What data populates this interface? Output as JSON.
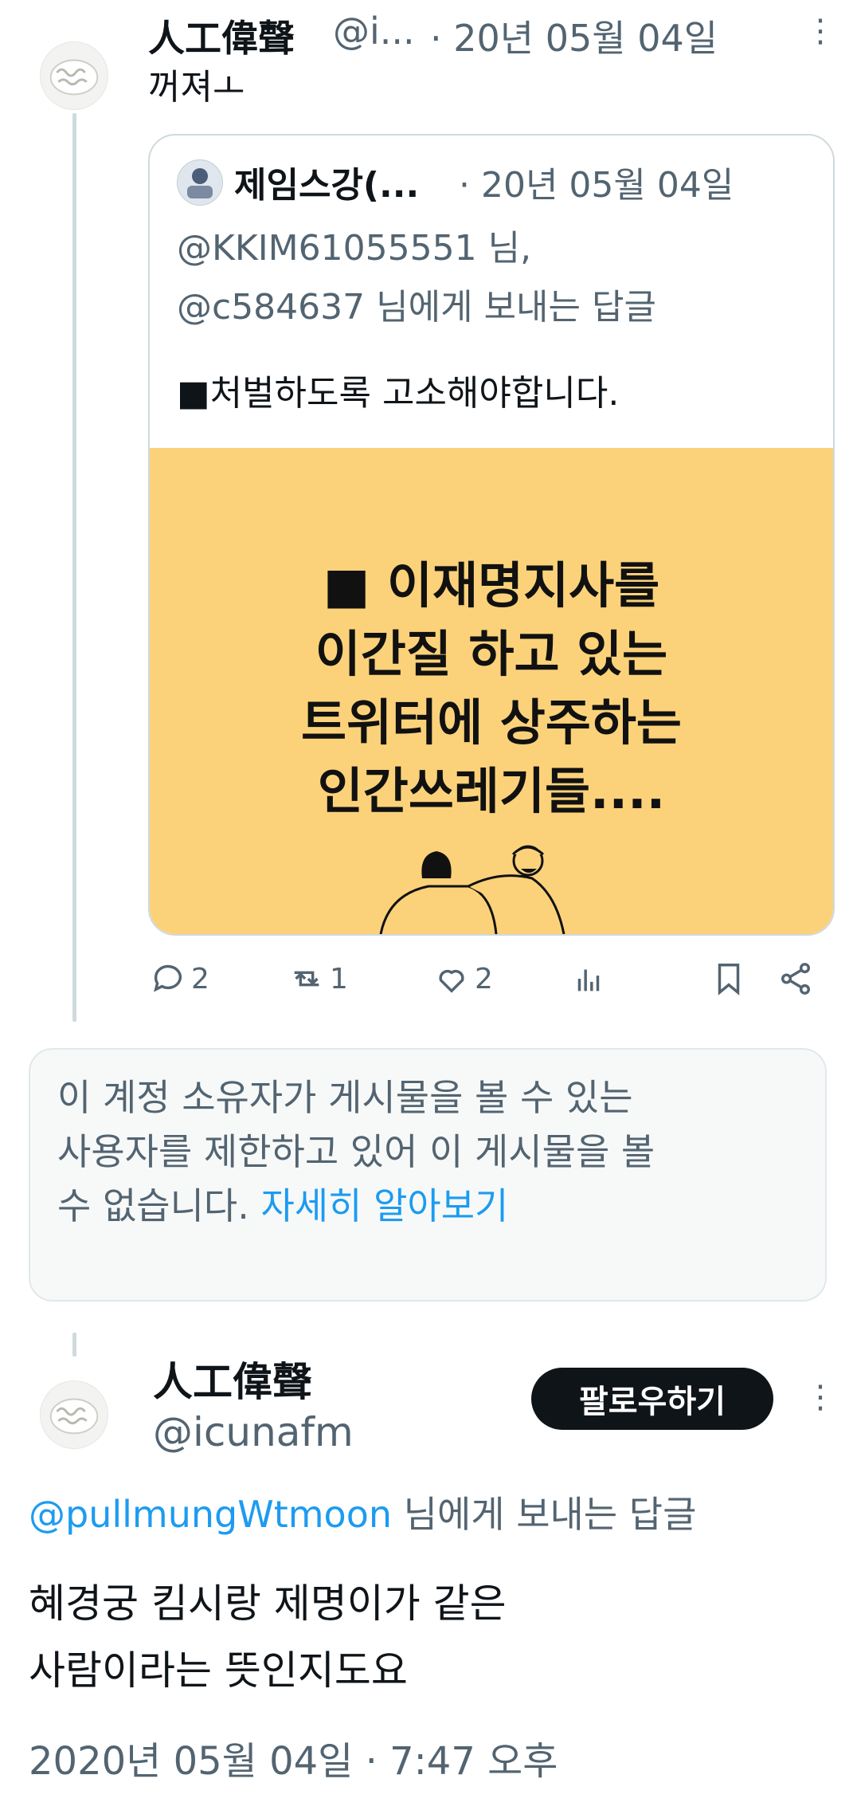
{
  "tweet1": {
    "display_name": "人工偉聲",
    "handle": "@i...",
    "date": "· 20년 05월 04일",
    "text": "꺼져ㅗ",
    "more_icon": "more-vertical-icon"
  },
  "quote": {
    "display_name": "제임스강(...",
    "date": "· 20년 05월 04일",
    "reply_line1": "@KKIM61055551 님,",
    "reply_line2": "@c584637 님에게 보내는 답글",
    "text": "■처벌하도록 고소해야합니다.",
    "image_lines": [
      "■ 이재명지사를",
      "이간질 하고 있는",
      "트위터에 상주하는",
      "인간쓰레기들...."
    ],
    "image_bg": "#fbd27a"
  },
  "actions": {
    "reply_count": "2",
    "retweet_count": "1",
    "like_count": "2"
  },
  "notice": {
    "line1": "이 계정 소유자가 게시물을 볼 수 있는",
    "line2": "사용자를 제한하고 있어 이 게시물을 볼",
    "line3": "수 없습니다.",
    "link": "자세히 알아보기"
  },
  "tweet2": {
    "display_name": "人工偉聲",
    "handle": "@icunafm",
    "follow_label": "팔로우하기",
    "reply_to_handle": "@pullmungWtmoon",
    "reply_to_suffix": " 님에게 보내는 답글",
    "text_line1": "혜경궁 킴시랑 제명이가 같은",
    "text_line2": "사람이라는 뜻인지도요",
    "timestamp": "2020년 05월 04일 · 7:47 오후"
  },
  "colors": {
    "accent": "#1d9bf0",
    "muted": "#536471",
    "follow_bg": "#0f1419"
  }
}
